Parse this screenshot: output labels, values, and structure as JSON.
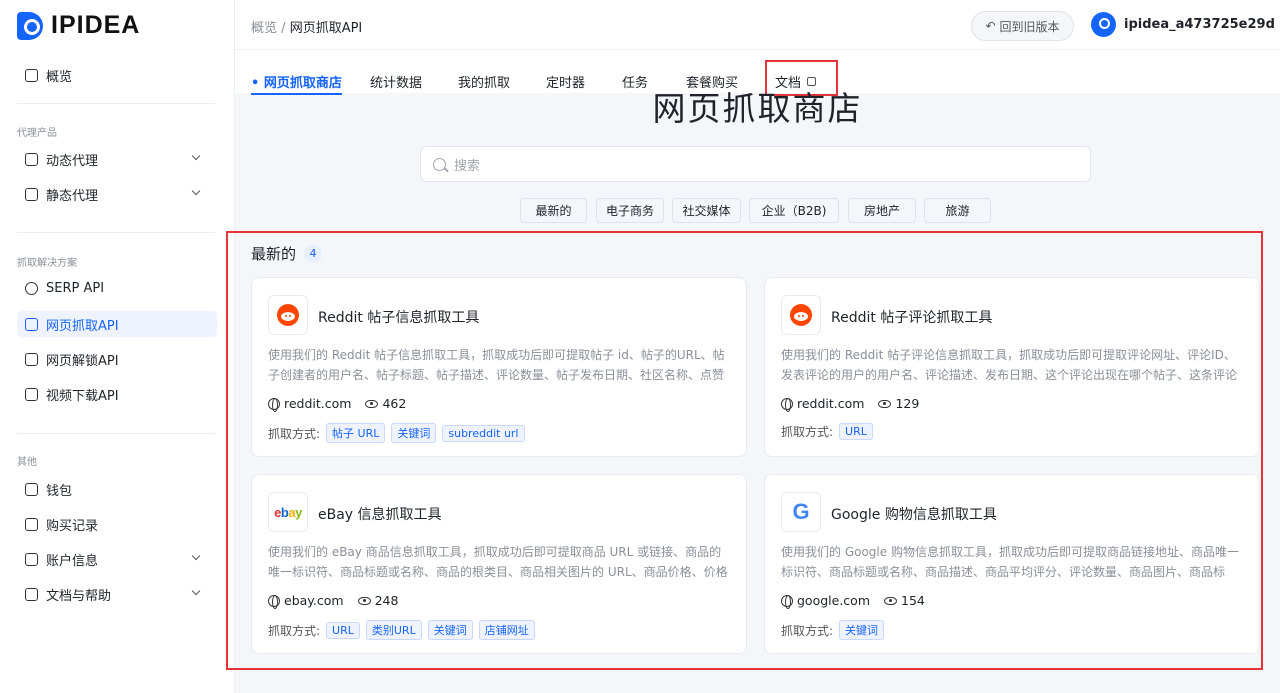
{
  "brand": {
    "name": "IPIDEA"
  },
  "sidebar": {
    "overview": "概览",
    "group_proxy": "代理产品",
    "dynamic_proxy": "动态代理",
    "static_proxy": "静态代理",
    "group_scrape": "抓取解决方案",
    "serp_api": "SERP API",
    "web_scrape_api": "网页抓取API",
    "web_unlock_api": "网页解锁API",
    "video_download_api": "视频下载API",
    "group_other": "其他",
    "wallet": "钱包",
    "purchase_history": "购买记录",
    "account_info": "账户信息",
    "docs_help": "文档与帮助"
  },
  "header": {
    "breadcrumb_root": "概览",
    "breadcrumb_sep": "/",
    "breadcrumb_current": "网页抓取API",
    "back_old": "回到旧版本",
    "username": "ipidea_a473725e29d"
  },
  "tabs": {
    "store": "• 网页抓取商店",
    "stats": "统计数据",
    "mine": "我的抓取",
    "timer": "定时器",
    "tasks": "任务",
    "plan": "套餐购买",
    "docs": "文档"
  },
  "main": {
    "title": "网页抓取商店",
    "search_placeholder": "搜索",
    "chips": [
      "最新的",
      "电子商务",
      "社交媒体",
      "企业（B2B)",
      "房地产",
      "旅游"
    ],
    "section_title": "最新的",
    "section_count": "4",
    "method_label": "抓取方式:"
  },
  "cards": [
    {
      "title": "Reddit 帖子信息抓取工具",
      "desc": "使用我们的 Reddit 帖子信息抓取工具，抓取成功后即可提取帖子 id、帖子的URL、帖子创建者的用户名、帖子标题、帖子描述、评论数量、帖子发布日期、社区名称、点赞数...",
      "domain": "reddit.com",
      "views": "462",
      "tags": [
        "帖子 URL",
        "关键词",
        "subreddit url"
      ]
    },
    {
      "title": "Reddit 帖子评论抓取工具",
      "desc": "使用我们的 Reddit 帖子评论信息抓取工具，抓取成功后即可提取评论网址、评论ID、发表评论的用户的用户名、评论描述、发布日期、这个评论出现在哪个帖子、这条评论出...",
      "domain": "reddit.com",
      "views": "129",
      "tags": [
        "URL"
      ]
    },
    {
      "title": "eBay 信息抓取工具",
      "desc": "使用我们的 eBay 商品信息抓取工具，抓取成功后即可提取商品 URL 或链接、商品的唯一标识符、商品标题或名称、商品的根类目、商品相关图片的 URL、商品价格、价格所...",
      "domain": "ebay.com",
      "views": "248",
      "tags": [
        "URL",
        "类别URL",
        "关键词",
        "店铺网址"
      ]
    },
    {
      "title": "Google 购物信息抓取工具",
      "desc": "使用我们的 Google 购物信息抓取工具，抓取成功后即可提取商品链接地址、商品唯一标识符、商品标题或名称、商品描述、商品平均评分、评论数量、商品图片、商品标签、...",
      "domain": "google.com",
      "views": "154",
      "tags": [
        "关键词"
      ]
    }
  ],
  "colors": {
    "accent": "#1664ff",
    "highlight_box": "#e5333a",
    "reddit": "#ff4500"
  }
}
